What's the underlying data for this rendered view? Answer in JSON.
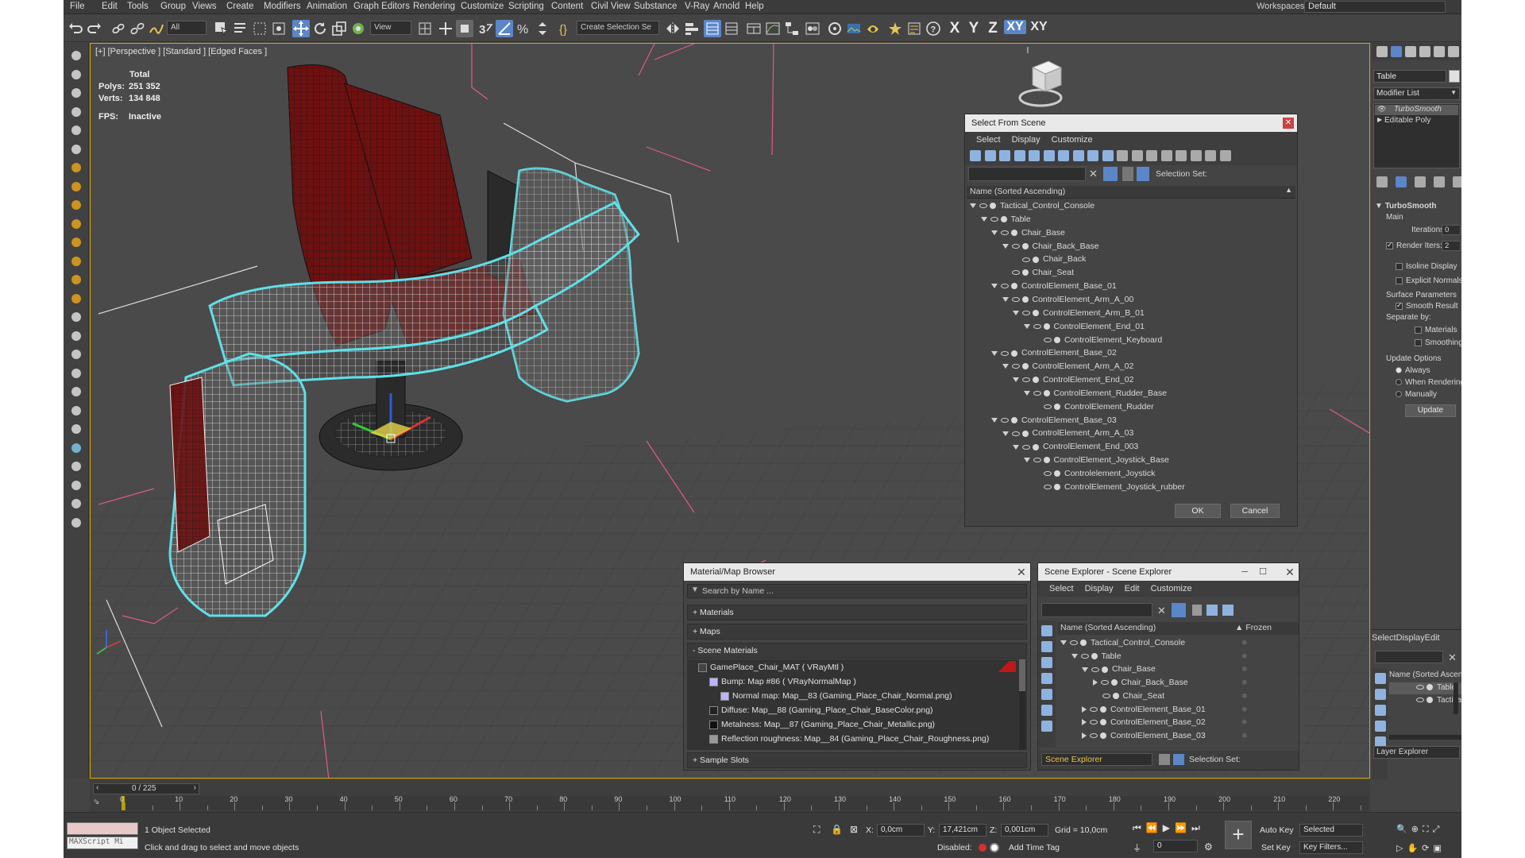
{
  "menu": [
    "File",
    "Edit",
    "Tools",
    "Group",
    "Views",
    "Create",
    "Modifiers",
    "Animation",
    "Graph Editors",
    "Rendering",
    "Customize",
    "Scripting",
    "Content",
    "Civil View",
    "Substance",
    "V-Ray",
    "Arnold",
    "Help"
  ],
  "workspaces_label": "Workspaces:",
  "workspaces_value": "Default",
  "toolbar": {
    "filter": "All",
    "ref_coord": "View",
    "selection_set": "Create Selection Se",
    "axes": [
      "X",
      "Y",
      "Z",
      "XY",
      "XY"
    ]
  },
  "viewport": {
    "label": "[+] [Perspective ] [Standard ] [Edged Faces ]",
    "stats": {
      "total": "Total",
      "polys_k": "Polys:",
      "polys_v": "251 352",
      "verts_k": "Verts:",
      "verts_v": "134 848",
      "fps_k": "FPS:",
      "fps_v": "Inactive"
    }
  },
  "select_from_scene": {
    "title": "Select From Scene",
    "menu": [
      "Select",
      "Display",
      "Customize"
    ],
    "selection_set": "Selection Set:",
    "column": "Name (Sorted Ascending)",
    "rows": [
      {
        "depth": 0,
        "label": "Tactical_Control_Console",
        "tri": "d"
      },
      {
        "depth": 1,
        "label": "Table",
        "tri": "d"
      },
      {
        "depth": 2,
        "label": "Chair_Base",
        "tri": "d"
      },
      {
        "depth": 3,
        "label": "Chair_Back_Base",
        "tri": "d"
      },
      {
        "depth": 4,
        "label": "Chair_Back",
        "tri": ""
      },
      {
        "depth": 3,
        "label": "Chair_Seat",
        "tri": ""
      },
      {
        "depth": 2,
        "label": "ControlElement_Base_01",
        "tri": "d"
      },
      {
        "depth": 3,
        "label": "ControlElement_Arm_A_00",
        "tri": "d"
      },
      {
        "depth": 4,
        "label": "ControlElement_Arm_B_01",
        "tri": "d"
      },
      {
        "depth": 5,
        "label": "ControlElement_End_01",
        "tri": "d"
      },
      {
        "depth": 6,
        "label": "ControlElement_Keyboard",
        "tri": ""
      },
      {
        "depth": 2,
        "label": "ControlElement_Base_02",
        "tri": "d"
      },
      {
        "depth": 3,
        "label": "ControlElement_Arm_A_02",
        "tri": "d"
      },
      {
        "depth": 4,
        "label": "ControlElement_End_02",
        "tri": "d"
      },
      {
        "depth": 5,
        "label": "ControlElement_Rudder_Base",
        "tri": "d"
      },
      {
        "depth": 6,
        "label": "ControlElement_Rudder",
        "tri": ""
      },
      {
        "depth": 2,
        "label": "ControlElement_Base_03",
        "tri": "d"
      },
      {
        "depth": 3,
        "label": "ControlElement_Arm_A_03",
        "tri": "d"
      },
      {
        "depth": 4,
        "label": "ControlElement_End_003",
        "tri": "d"
      },
      {
        "depth": 5,
        "label": "ControlElement_Joystick_Base",
        "tri": "d"
      },
      {
        "depth": 6,
        "label": "Controlelement_Joystick",
        "tri": ""
      },
      {
        "depth": 6,
        "label": "ControlElement_Joystick_rubber",
        "tri": ""
      }
    ],
    "ok": "OK",
    "cancel": "Cancel"
  },
  "material_browser": {
    "title": "Material/Map Browser",
    "search_placeholder": "Search by Name ...",
    "sections": [
      "+ Materials",
      "+ Maps",
      "- Scene Materials"
    ],
    "items": [
      "GamePlace_Chair_MAT  ( VRayMtl )",
      "Bump: Map #86  ( VRayNormalMap )",
      "Normal map: Map__83 (Gaming_Place_Chair_Normal.png)",
      "Diffuse: Map__88 (Gaming_Place_Chair_BaseColor.png)",
      "Metalness: Map__87 (Gaming_Place_Chair_Metallic.png)",
      "Reflection roughness: Map__84 (Gaming_Place_Chair_Roughness.png)"
    ],
    "sample_slots": "+ Sample Slots"
  },
  "scene_explorer": {
    "title": "Scene Explorer - Scene Explorer",
    "menu": [
      "Select",
      "Display",
      "Edit",
      "Customize"
    ],
    "column": "Name (Sorted Ascending)",
    "frozen": "Frozen",
    "rows": [
      {
        "depth": 0,
        "label": "Tactical_Control_Console",
        "tri": "d"
      },
      {
        "depth": 1,
        "label": "Table",
        "tri": "d"
      },
      {
        "depth": 2,
        "label": "Chair_Base",
        "tri": "d"
      },
      {
        "depth": 3,
        "label": "Chair_Back_Base",
        "tri": "r"
      },
      {
        "depth": 3,
        "label": "Chair_Seat",
        "tri": ""
      },
      {
        "depth": 2,
        "label": "ControlElement_Base_01",
        "tri": "r"
      },
      {
        "depth": 2,
        "label": "ControlElement_Base_02",
        "tri": "r"
      },
      {
        "depth": 2,
        "label": "ControlElement_Base_03",
        "tri": "r"
      }
    ],
    "footer_name": "Scene Explorer",
    "selection_set": "Selection Set:"
  },
  "command_panel": {
    "object_name": "Table",
    "modifier_list": "Modifier List",
    "stack": [
      "TurboSmooth",
      "Editable Poly"
    ],
    "rollout": "TurboSmooth",
    "main": "Main",
    "iterations_k": "Iterations:",
    "iterations_v": "0",
    "render_iters_k": "Render Iters:",
    "render_iters_v": "2",
    "isoline": "Isoline Display",
    "explicit": "Explicit Normals",
    "surface_params": "Surface Parameters",
    "smooth_result": "Smooth Result",
    "separate_by": "Separate by:",
    "materials": "Materials",
    "smoothing_groups": "Smoothing Groups",
    "update_options": "Update Options",
    "always": "Always",
    "when_rendering": "When Rendering",
    "manually": "Manually",
    "update": "Update"
  },
  "layer_explorer": {
    "menu": [
      "Select",
      "Display",
      "Edit"
    ],
    "column": "Name (Sorted Ascending)",
    "rows": [
      "Table",
      "Tactical_Control_Co"
    ],
    "footer": "Layer Explorer"
  },
  "timeline": {
    "frame": "0 / 225",
    "ticks": [
      "0",
      "10",
      "20",
      "30",
      "40",
      "50",
      "60",
      "70",
      "80",
      "90",
      "100",
      "110",
      "120",
      "130",
      "140",
      "150",
      "160",
      "170",
      "180",
      "190",
      "200",
      "210",
      "220"
    ]
  },
  "status": {
    "maxscript": "MAXScript Mi",
    "selected": "1 Object Selected",
    "hint": "Click and drag to select and move objects",
    "x_k": "X:",
    "x_v": "0,0cm",
    "y_k": "Y:",
    "y_v": "17,421cm",
    "z_k": "Z:",
    "z_v": "0,001cm",
    "grid": "Grid = 10,0cm",
    "disabled": "Disabled:",
    "add_time_tag": "Add Time Tag",
    "auto_key": "Auto Key",
    "set_key": "Set Key",
    "selected_drop": "Selected",
    "key_filters": "Key Filters...",
    "frame_field": "0"
  },
  "colors": {
    "selection": "#5fe0e8",
    "wire": "#ffffff",
    "chair_red": "#7a1010",
    "accent": "#5b86c8"
  }
}
